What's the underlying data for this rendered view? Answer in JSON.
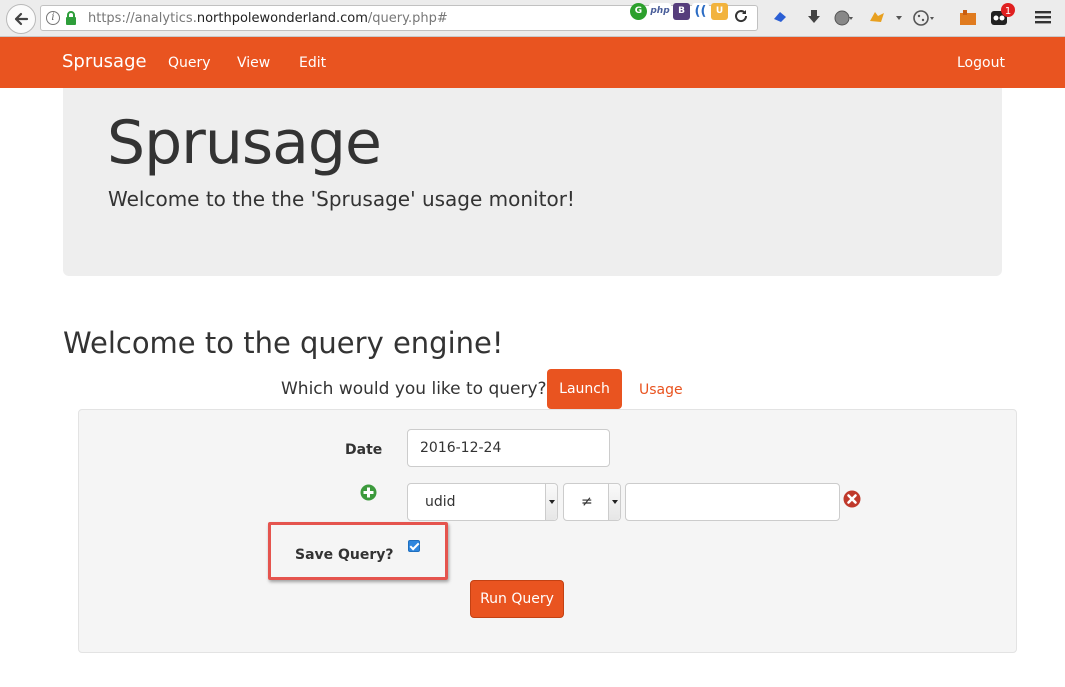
{
  "browser": {
    "url_prefix": "https://analytics.",
    "url_domain": "northpolewonderland.com",
    "url_path": "/query.php#",
    "notification_count": "1"
  },
  "nav": {
    "brand": "Sprusage",
    "links": [
      "Query",
      "View",
      "Edit"
    ],
    "logout": "Logout"
  },
  "jumbotron": {
    "title": "Sprusage",
    "subtitle": "Welcome to the the 'Sprusage' usage monitor!"
  },
  "query": {
    "heading": "Welcome to the query engine!",
    "prompt": "Which would you like to query?",
    "tabs": [
      "Launch",
      "Usage"
    ],
    "date_label": "Date",
    "date_value": "2016-12-24",
    "field_select": "udid",
    "operator_select": "≠",
    "value_input": "",
    "save_label": "Save Query?",
    "save_checked": true,
    "run_button": "Run Query"
  },
  "colors": {
    "accent": "#e95420",
    "jumbotron_bg": "#eeeeee",
    "highlight_border": "#e5544e"
  }
}
